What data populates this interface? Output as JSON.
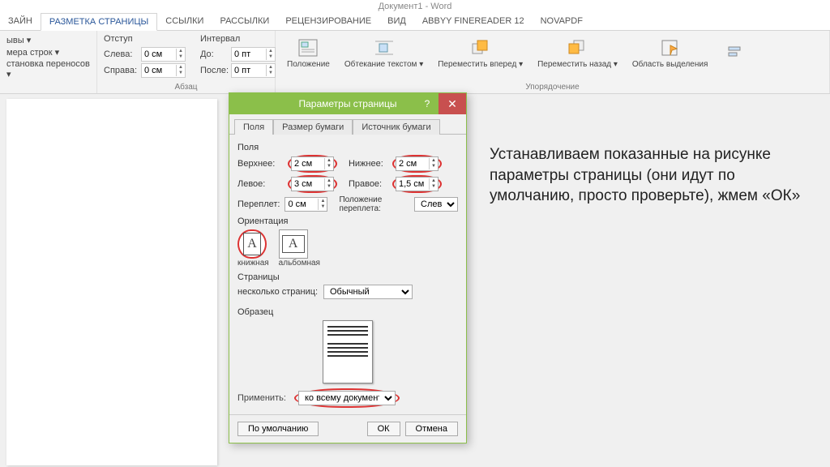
{
  "title": "Документ1 - Word",
  "tabs": [
    "ЗАЙН",
    "РАЗМЕТКА СТРАНИЦЫ",
    "ССЫЛКИ",
    "РАССЫЛКИ",
    "РЕЦЕНЗИРОВАНИЕ",
    "ВИД",
    "ABBYY FineReader 12",
    "novaPDF"
  ],
  "ribbon": {
    "group1": {
      "items": [
        "ывы ▾",
        "мера строк ▾",
        "становка переносов ▾"
      ]
    },
    "indent": {
      "title": "Отступ",
      "left_label": "Слева:",
      "left_val": "0 см",
      "right_label": "Справа:",
      "right_val": "0 см"
    },
    "interval": {
      "title": "Интервал",
      "before_label": "До:",
      "before_val": "0 пт",
      "after_label": "После:",
      "after_val": "0 пт"
    },
    "para_title": "Абзац",
    "arrange": {
      "title": "Упорядочение",
      "pos": "Положение",
      "wrap": "Обтекание текстом ▾",
      "fwd": "Переместить вперед ▾",
      "back": "Переместить назад ▾",
      "pane": "Область выделения"
    }
  },
  "dialog": {
    "title": "Параметры страницы",
    "tabs": [
      "Поля",
      "Размер бумаги",
      "Источник бумаги"
    ],
    "margins_label": "Поля",
    "top_l": "Верхнее:",
    "top_v": "2 см",
    "bottom_l": "Нижнее:",
    "bottom_v": "2 см",
    "left_l": "Левое:",
    "left_v": "3 см",
    "right_l": "Правое:",
    "right_v": "1,5 см",
    "gutter_l": "Переплет:",
    "gutter_v": "0 см",
    "gutpos_l": "Положение переплета:",
    "gutpos_v": "Слева",
    "orient_label": "Ориентация",
    "orient_portrait": "книжная",
    "orient_landscape": "альбомная",
    "pages_label": "Страницы",
    "multi_l": "несколько страниц:",
    "multi_v": "Обычный",
    "sample_label": "Образец",
    "apply_l": "Применить:",
    "apply_v": "ко всему документу",
    "default_btn": "По умолчанию",
    "ok_btn": "ОК",
    "cancel_btn": "Отмена"
  },
  "annotation": "Устанавливаем показанные на рисунке параметры страницы (они идут по умолчанию, просто проверьте), жмем «ОК»"
}
